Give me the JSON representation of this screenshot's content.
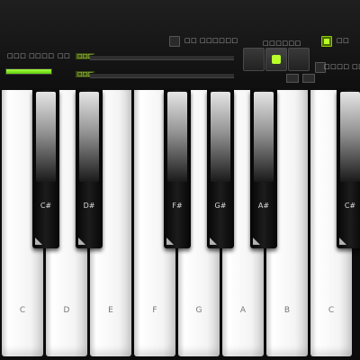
{
  "panel": {
    "left_label": "□□□ □□□□",
    "left_value": "□□",
    "level_percent": 100,
    "slider1_label": "□□□",
    "slider2_label": "□□□",
    "toggle_label": "□□ □□□□□□",
    "octave_label": "□□□□□□",
    "right_label": "□□□□ □□□",
    "colors": {
      "accent": "#b8ff2a",
      "panel_bg": "#1a1a1a"
    }
  },
  "keys": {
    "white": [
      "C",
      "D",
      "E",
      "F",
      "G",
      "A",
      "B",
      "C"
    ],
    "black": [
      "C#",
      "D#",
      "F#",
      "G#",
      "A#",
      "C#"
    ]
  }
}
